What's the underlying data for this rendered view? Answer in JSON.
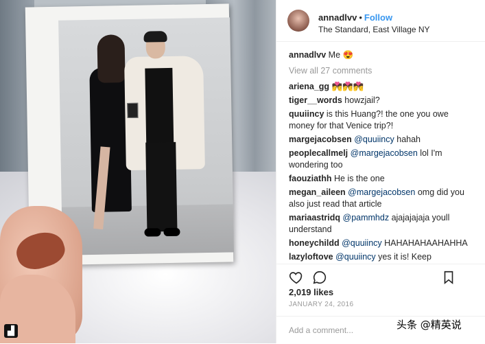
{
  "post": {
    "username": "annadlvv",
    "separator": "•",
    "follow_label": "Follow",
    "location": "The Standard, East Village NY",
    "caption_user": "annadlvv",
    "caption_text": "Me 😍",
    "view_all": "View all 27 comments",
    "comments": [
      {
        "user": "ariena_gg",
        "mention": "",
        "text": "💏💏💏"
      },
      {
        "user": "tiger__words",
        "mention": "",
        "text": "howzjail?"
      },
      {
        "user": "quuiincy",
        "mention": "",
        "text": "is this Huang?! the one you owe money for that Venice trip?!"
      },
      {
        "user": "margejacobsen",
        "mention": "@quuiincy",
        "text": "hahah"
      },
      {
        "user": "peoplecallmelj",
        "mention": "@margejacobsen",
        "text": "lol I'm wondering too"
      },
      {
        "user": "faouziathh",
        "mention": "",
        "text": "He is the one"
      },
      {
        "user": "megan_aileen",
        "mention": "@margejacobsen",
        "text": "omg did you also just read that article"
      },
      {
        "user": "mariaastridq",
        "mention": "@pammhdz",
        "text": "ajajajajaja youll understand"
      },
      {
        "user": "honeychildd",
        "mention": "@quuiincy",
        "text": "HAHAHAHAAHAHHA"
      },
      {
        "user": "lazyloftove",
        "mention": "@quuiincy",
        "text": "yes it is! Keep"
      }
    ],
    "likes": "2,019 likes",
    "date": "JANUARY 24, 2016",
    "add_comment_placeholder": "Add a comment..."
  },
  "watermark": "头条 @精英说",
  "icons": {
    "like": "heart-icon",
    "comment": "comment-bubble-icon",
    "save": "bookmark-icon",
    "corner": "instagram-glyph-icon"
  },
  "colors": {
    "follow": "#3897f0",
    "mention": "#003569",
    "muted": "#999999",
    "text": "#262626"
  }
}
